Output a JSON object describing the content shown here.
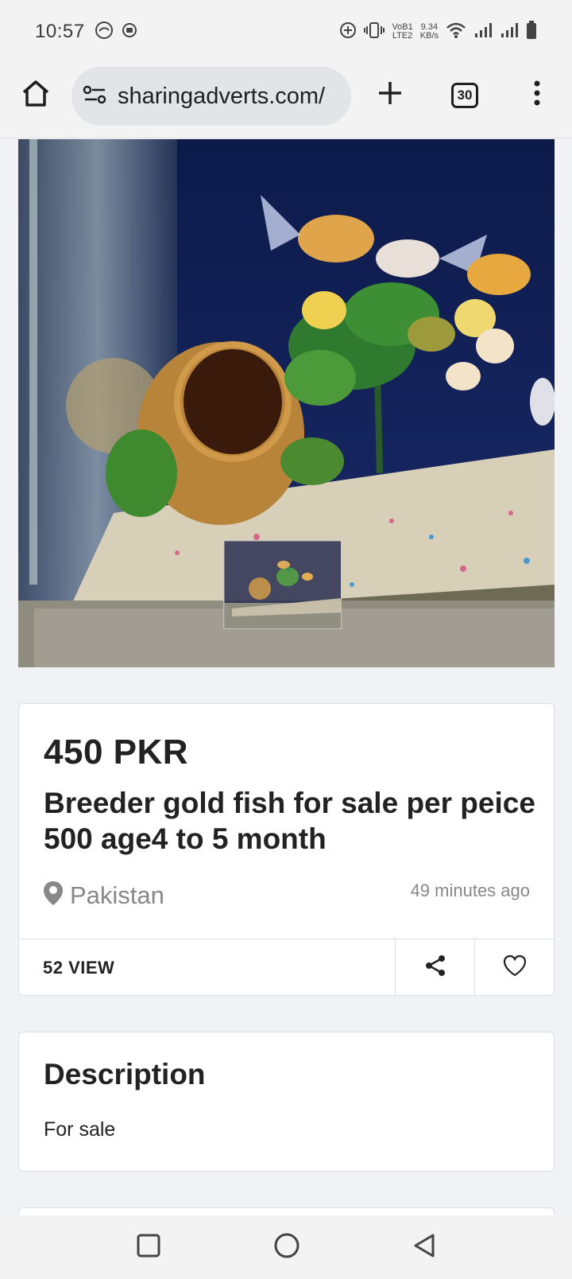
{
  "status_bar": {
    "time": "10:57",
    "network_line1": "VoB1",
    "network_line2": "LTE2",
    "speed_value": "9.34",
    "speed_unit": "KB/s"
  },
  "browser": {
    "url": "sharingadverts.com/",
    "tab_count": "30"
  },
  "listing": {
    "price": "450 PKR",
    "title": "Breeder gold fish for sale per peice 500 age4 to 5 month",
    "location": "Pakistan",
    "posted": "49 minutes ago",
    "views": "52 VIEW"
  },
  "description": {
    "heading": "Description",
    "text": "For sale"
  }
}
